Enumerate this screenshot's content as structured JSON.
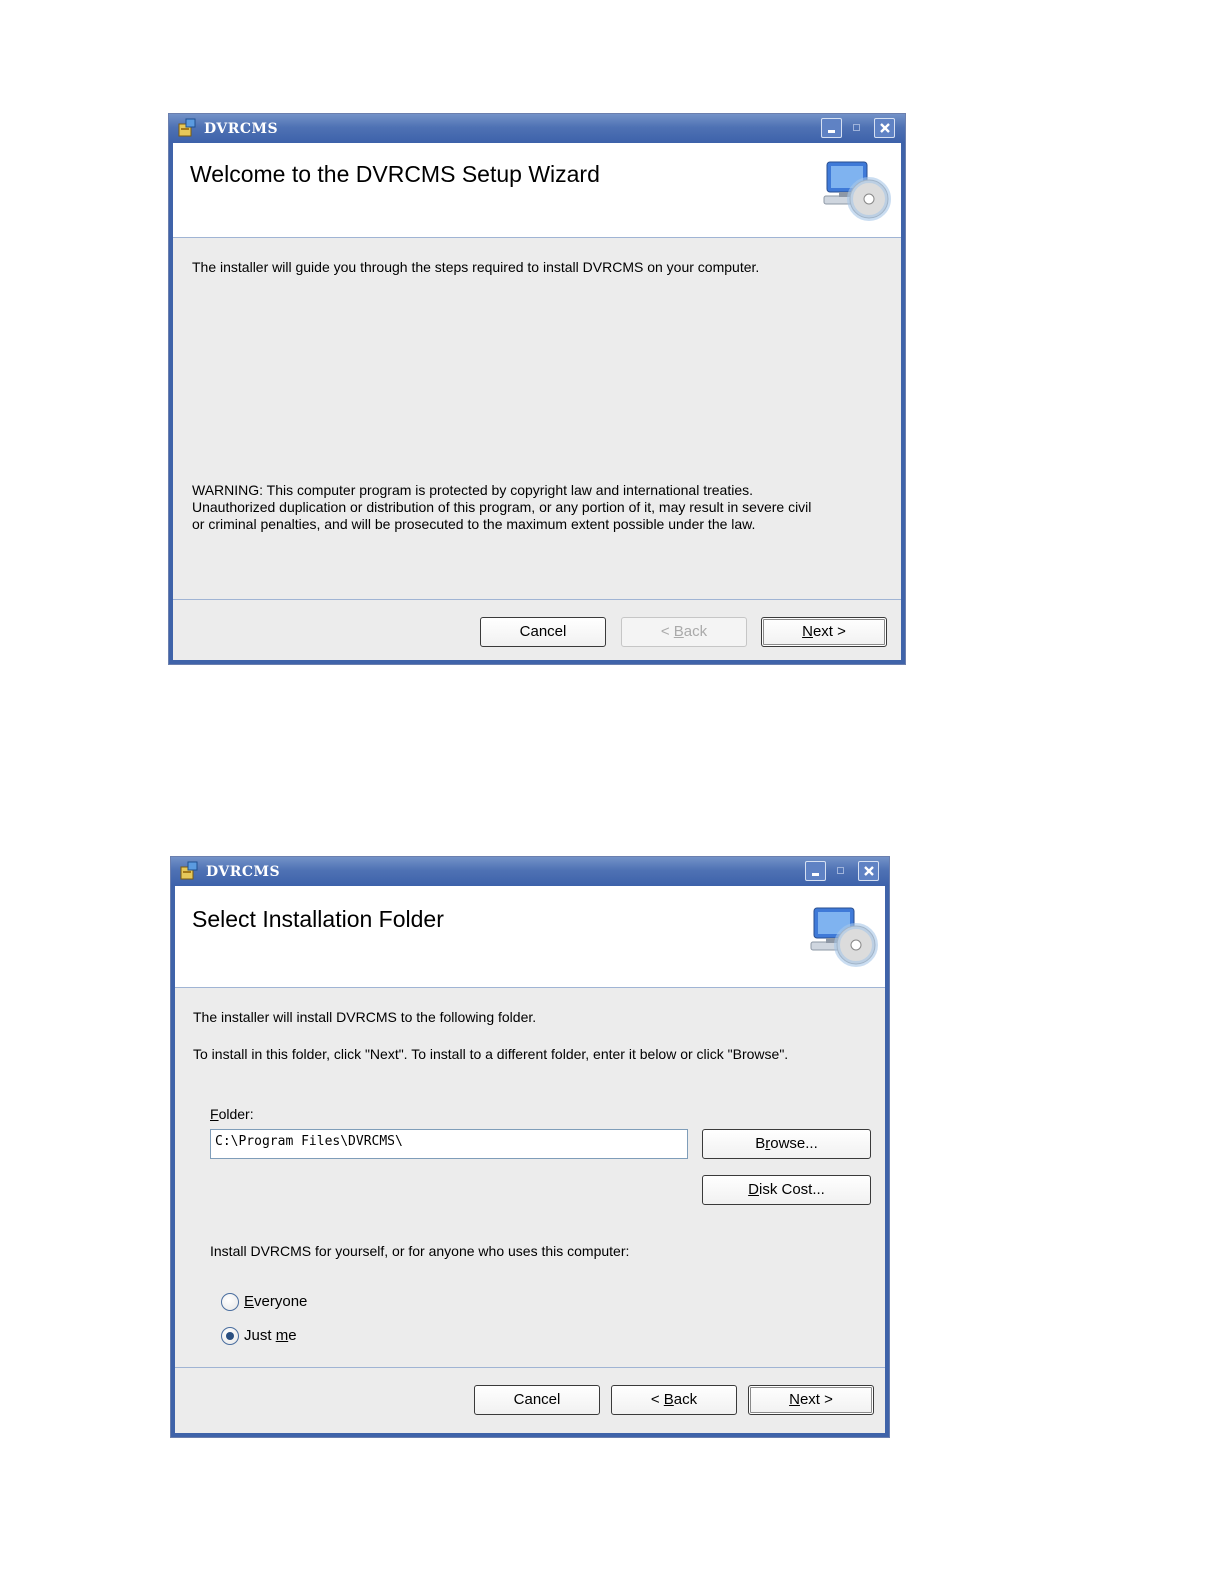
{
  "dialog1": {
    "title": "DVRCMS",
    "banner_title": "Welcome to the DVRCMS Setup Wizard",
    "intro": "The installer will guide you through the steps required to install DVRCMS on your computer.",
    "warning_line1": "WARNING: This computer program is protected by copyright law and international treaties.",
    "warning_line2": "Unauthorized duplication or distribution of this program, or any portion of it, may result in severe civil",
    "warning_line3": "or criminal penalties, and will be prosecuted to the maximum extent possible under the law.",
    "cancel_label": "Cancel",
    "back_label": "< Back",
    "next_label": "Next >",
    "back_enabled": false
  },
  "dialog2": {
    "title": "DVRCMS",
    "banner_title": "Select Installation Folder",
    "line1": "The installer will install DVRCMS to the following folder.",
    "line2": "To install in this folder, click \"Next\". To install to a different folder, enter it below or click \"Browse\".",
    "folder_label": "Folder:",
    "folder_value": "C:\\Program Files\\DVRCMS\\",
    "browse_label": "Browse...",
    "disk_cost_label": "Disk Cost...",
    "install_for_prompt": "Install DVRCMS for yourself, or for anyone who uses this computer:",
    "radio_options": [
      "Everyone",
      "Just me"
    ],
    "selected_option": "Just me",
    "cancel_label": "Cancel",
    "back_label": "< Back",
    "next_label": "Next >"
  },
  "icons": {
    "app": "installer-package-icon",
    "banner": "computer-with-cd-icon",
    "minimize": "minimize-icon",
    "maximize": "maximize-icon",
    "close": "close-icon"
  }
}
